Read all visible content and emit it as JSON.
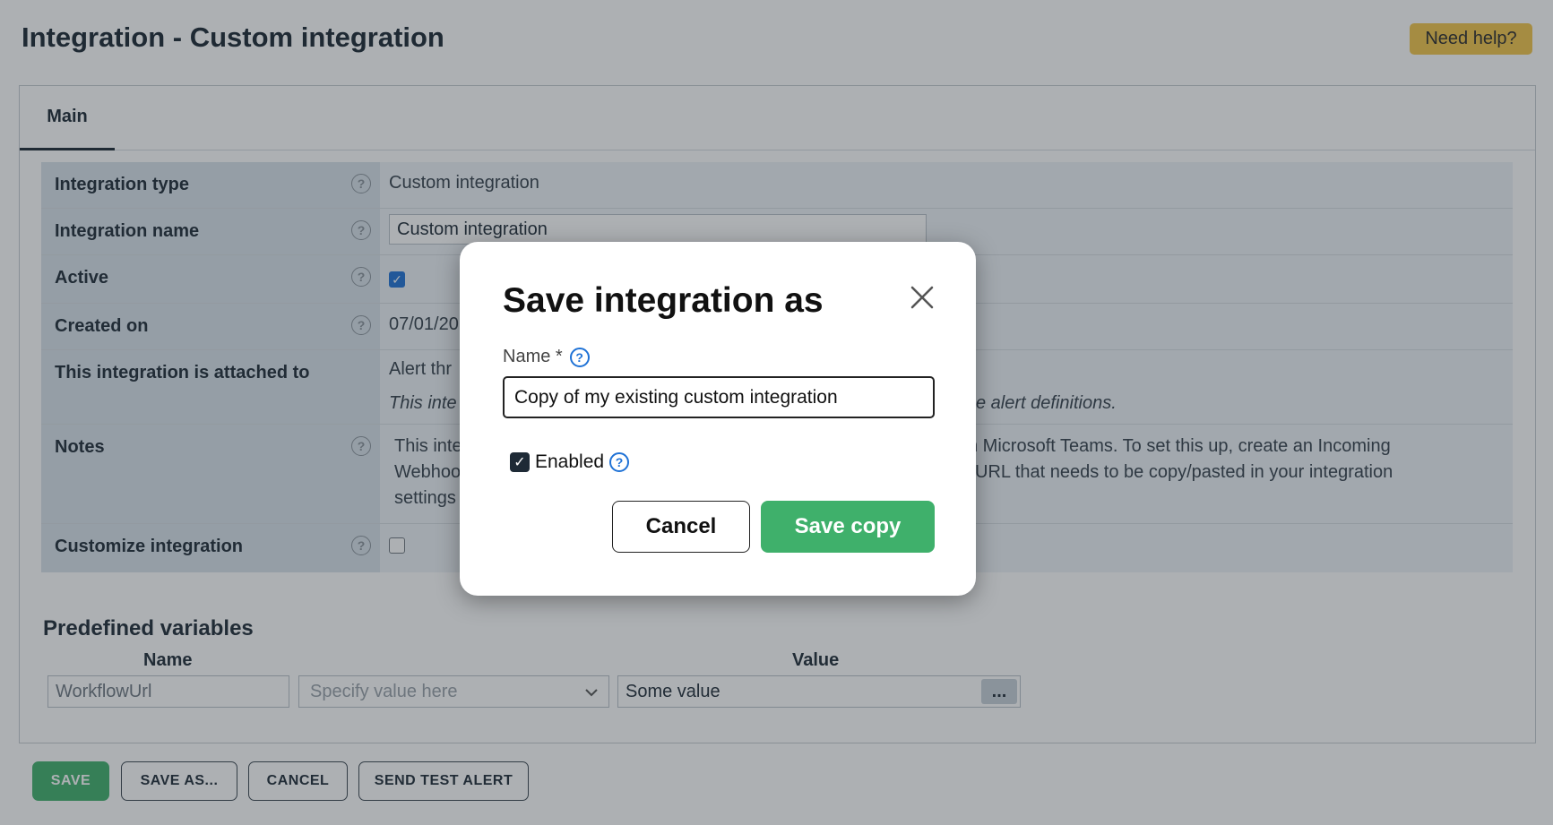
{
  "page": {
    "title": "Integration - Custom integration",
    "help_label": "Need help?"
  },
  "tabs": [
    {
      "label": "Main"
    }
  ],
  "form": {
    "integration_type": {
      "label": "Integration type",
      "value": "Custom integration"
    },
    "integration_name": {
      "label": "Integration name",
      "value": "Custom integration"
    },
    "active": {
      "label": "Active",
      "checked": true
    },
    "created_on": {
      "label": "Created on",
      "value": "07/01/20"
    },
    "attached_to": {
      "label": "This integration is attached to",
      "value": "Alert thr",
      "note": "This inte",
      "note_tail": "e alert definitions."
    },
    "notes": {
      "label": "Notes",
      "line1_start": "This inte",
      "line1_end": "n Microsoft Teams. To set this up, create an Incoming",
      "line2_start": "Webhoo",
      "line2_end": "URL that needs to be copy/pasted in your integration",
      "line3_start": "settings"
    },
    "customize": {
      "label": "Customize integration",
      "checked": false
    }
  },
  "predefined_variables": {
    "title": "Predefined variables",
    "col_name": "Name",
    "col_value": "Value",
    "rows": [
      {
        "name": "WorkflowUrl",
        "select_placeholder": "Specify value here",
        "value": "Some value",
        "more_label": "..."
      }
    ]
  },
  "footer": {
    "save": "SAVE",
    "save_as": "SAVE AS...",
    "cancel": "CANCEL",
    "send_test": "SEND TEST ALERT"
  },
  "modal": {
    "title": "Save integration as",
    "name_label": "Name *",
    "name_value": "Copy of my existing custom integration",
    "enabled_label": "Enabled",
    "enabled": true,
    "cancel_label": "Cancel",
    "save_label": "Save copy"
  },
  "colors": {
    "accent_green": "#3fb06b",
    "help_yellow": "#f2c64a",
    "info_blue": "#1f72d6"
  }
}
